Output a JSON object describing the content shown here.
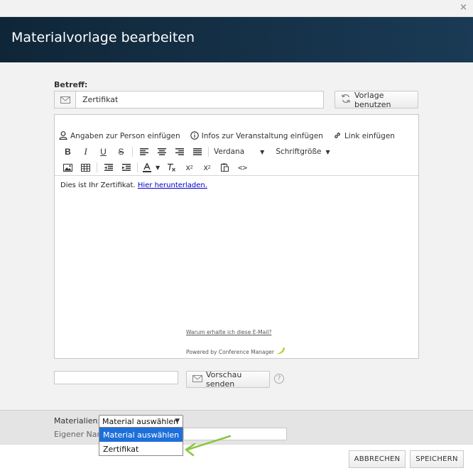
{
  "window": {
    "close_glyph": "×",
    "title": "Materialvorlage bearbeiten"
  },
  "form": {
    "subject_label": "Betreff:",
    "subject_value": "Zertifikat",
    "use_template_label": "Vorlage benutzen"
  },
  "toolbar": {
    "person_label": "Angaben zur Person einfügen",
    "event_label": "Infos zur Veranstaltung einfügen",
    "link_label": "Link einfügen",
    "font_value": "Verdana",
    "size_label": "Schriftgröße"
  },
  "editor": {
    "body_text": "Dies ist Ihr Zertifikat.",
    "body_link": "Hier herunterladen.",
    "footer_why": "Warum erhalte ich diese E-Mail?",
    "footer_powered": "Powered by Conference Manager"
  },
  "preview": {
    "send_label": "Vorschau senden",
    "help_glyph": "?"
  },
  "materials": {
    "label": "Materialien:",
    "selected": "Material auswählen",
    "own_name_label": "Eigener Nam",
    "options": [
      "Material auswählen",
      "Zertifikat"
    ]
  },
  "actions": {
    "cancel_label": "ABBRECHEN",
    "save_label": "SPEICHERN"
  },
  "colors": {
    "header_bg": "#132c42",
    "dropdown_highlight": "#1e6fd9",
    "annotation_arrow": "#8cc63f"
  }
}
